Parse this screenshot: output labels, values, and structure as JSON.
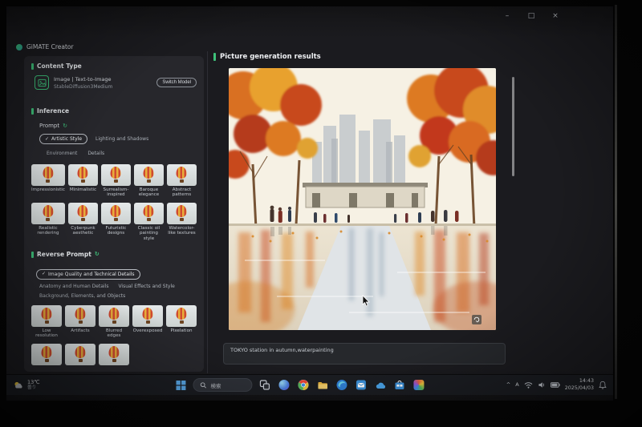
{
  "icons": {
    "minimize": "–",
    "maximize": "□",
    "close": "×",
    "check": "✓",
    "refresh": "↻",
    "chevron_up": "^"
  },
  "app": {
    "title": "GiMATE Creator",
    "sidebar": {
      "content_type": {
        "header": "Content Type",
        "mode_label": "Image | Text-to-Image",
        "model_name": "StableDiffusion3Medium",
        "switch_button": "Switch Model"
      },
      "inference": {
        "header": "Inference",
        "prompt_label": "Prompt",
        "tabs": [
          "Artistic Style",
          "Lighting and Shadows",
          "Environment",
          "Details"
        ],
        "styles": [
          "Impressionistic",
          "Minimalistic",
          "Surrealism-inspired",
          "Baroque elegance",
          "Abstract patterns",
          "Realistic rendering",
          "Cyberpunk aesthetic",
          "Futuristic designs",
          "Classic oil painting style",
          "Watercolor-like textures"
        ]
      },
      "reverse_prompt": {
        "header": "Reverse Prompt",
        "categories": [
          "Image Quality and Technical Details",
          "Anatomy and Human Details",
          "Visual Effects and Style",
          "Background, Elements, and Objects"
        ],
        "styles": [
          "Low resolution",
          "Artifacts",
          "Blurred edges",
          "Overexposed",
          "Pixelation"
        ]
      }
    },
    "main": {
      "header": "Picture generation results",
      "prompt_text": "TOKYO station in autumn,waterpainting"
    }
  },
  "taskbar": {
    "weather_temp": "13℃",
    "weather_condition": "曇り",
    "search_placeholder": "検索",
    "ime": "A",
    "time": "14:43",
    "date": "2025/04/03",
    "apps": [
      "windows",
      "task-view",
      "copilot",
      "chrome",
      "folder",
      "edge",
      "mail",
      "onedrive",
      "store",
      "photos"
    ]
  },
  "colors": {
    "accent": "#3ec27a"
  }
}
